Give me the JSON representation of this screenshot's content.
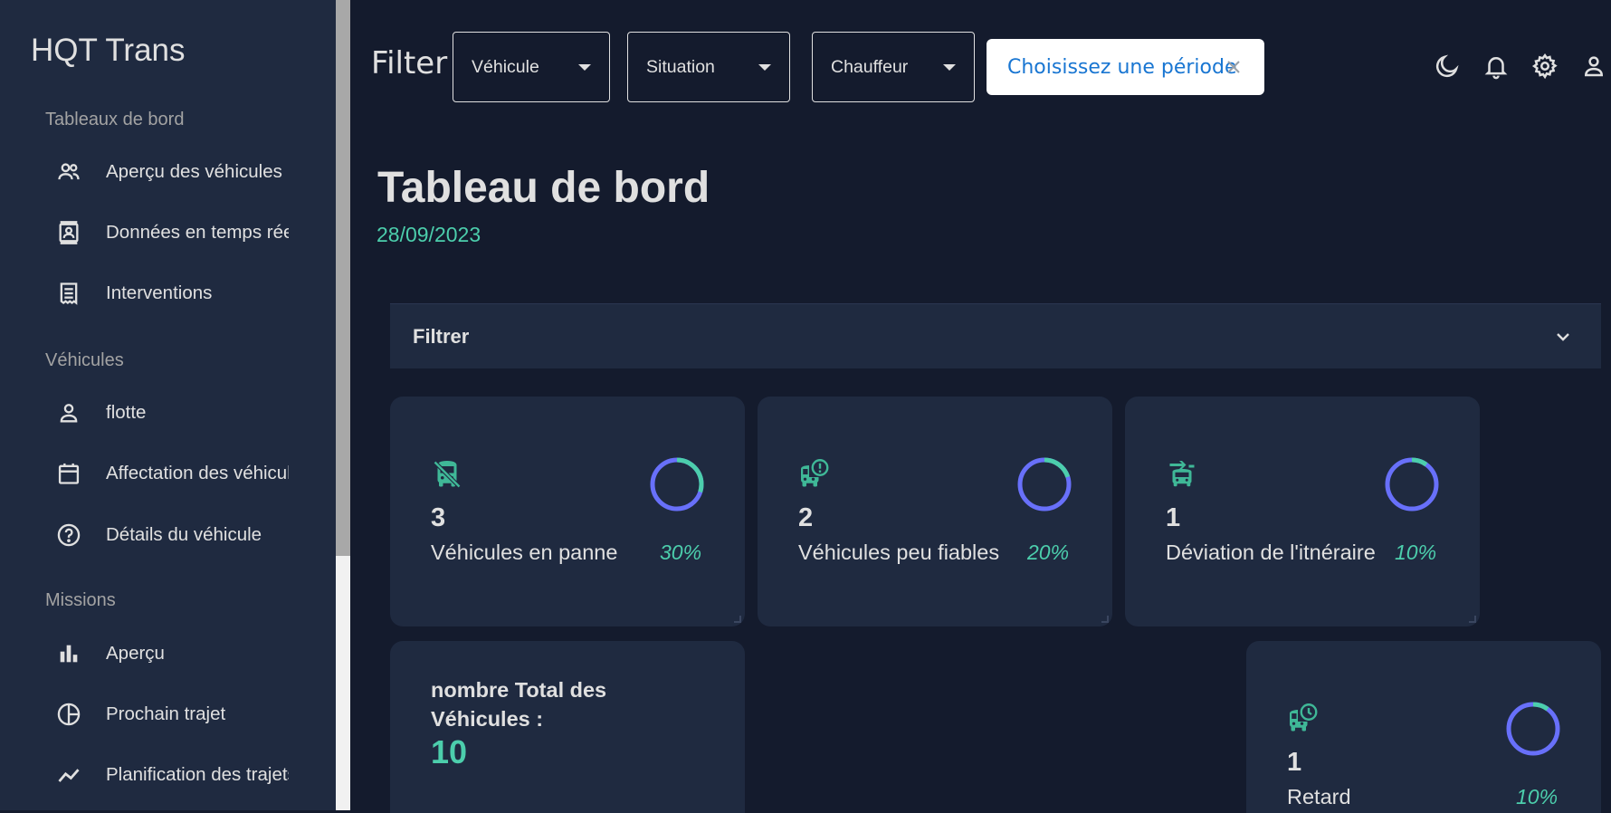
{
  "sidebar": {
    "brand": "HQT Trans",
    "sections": [
      {
        "title": "Tableaux de bord"
      },
      {
        "title": "Véhicules"
      },
      {
        "title": "Missions"
      }
    ],
    "items": [
      {
        "label": "Aperçu des véhicules",
        "icon": "people-icon"
      },
      {
        "label": "Données en temps réel",
        "icon": "contacts-icon"
      },
      {
        "label": "Interventions",
        "icon": "receipt-icon"
      },
      {
        "label": "flotte",
        "icon": "person-icon"
      },
      {
        "label": "Affectation des véhicules",
        "icon": "calendar-icon"
      },
      {
        "label": "Détails du véhicule",
        "icon": "help-circle-icon"
      },
      {
        "label": "Aperçu",
        "icon": "bar-chart-icon"
      },
      {
        "label": "Prochain trajet",
        "icon": "pie-chart-icon"
      },
      {
        "label": "Planification des trajets",
        "icon": "timeline-icon"
      }
    ]
  },
  "topbar": {
    "filter_label": "Filter",
    "dropdowns": [
      {
        "label": "Véhicule"
      },
      {
        "label": "Situation"
      },
      {
        "label": "Chauffeur"
      }
    ],
    "period": {
      "label": "Choisissez une période"
    },
    "icons": [
      "dark-mode-icon",
      "notifications-icon",
      "settings-icon",
      "user-icon"
    ]
  },
  "header": {
    "title": "Tableau de bord",
    "date": "28/09/2023"
  },
  "accordion": {
    "title": "Filtrer"
  },
  "stats": [
    {
      "value": "3",
      "label": "Véhicules en panne",
      "percent": "30%",
      "progress": 0.3,
      "icon": "bus-off-icon"
    },
    {
      "value": "2",
      "label": "Véhicules peu fiables",
      "percent": "20%",
      "progress": 0.2,
      "icon": "bus-alert-icon"
    },
    {
      "value": "1",
      "label": "Déviation de l'itnéraire",
      "percent": "10%",
      "progress": 0.1,
      "icon": "bus-route-icon"
    },
    {
      "value": "1",
      "label": "Retard",
      "percent": "10%",
      "progress": 0.1,
      "icon": "bus-clock-icon"
    }
  ],
  "total": {
    "label": "nombre Total des Véhicules :",
    "value": "10"
  },
  "colors": {
    "background": "#141b2d",
    "panel": "#1f2a40",
    "accent": "#4cceac",
    "ring": "#6870fa",
    "text": "#e0e0e0"
  }
}
